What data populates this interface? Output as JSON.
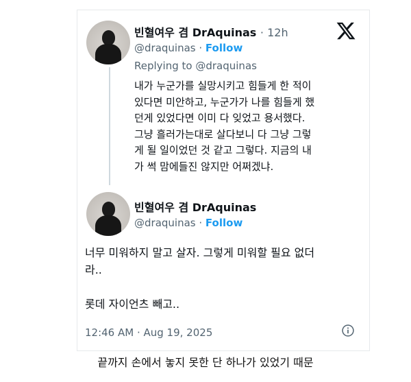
{
  "tweet1": {
    "display_name": "빈혈여우 겸 DrAquinas",
    "time": "· 12h",
    "handle": "@draquinas",
    "follow_label": "Follow",
    "replying_to_prefix": "Replying to",
    "replying_to_handle": "@draquinas",
    "text": "내가 누군가를 실망시키고 힘들게 한 적이\n있다면 미안하고, 누군가가 나를 힘들게 했\n던게 있었다면 이미 다 잊었고 용서했다.\n그냥 흘러가는대로 살다보니 다 그냥 그렇\n게 될 일이었던 것 같고 그렇다. 지금의 내\n가 썩 맘에들진 않지만 어쩌겠냐."
  },
  "tweet2": {
    "display_name": "빈혈여우 겸 DrAquinas",
    "handle": "@draquinas",
    "follow_label": "Follow",
    "text": "너무 미워하지 말고 살자. 그렇게 미워할 필요 없더\n라..\n\n롯데 자이언츠 빼고..",
    "timestamp": "12:46 AM · Aug 19, 2025"
  },
  "caption": "끝까지 손에서 놓지 못한 단 하나가 있었기 때문",
  "icons": {
    "brand": "x-logo-icon",
    "info": "info-icon"
  },
  "colors": {
    "follow": "#1d9bf0",
    "secondary_text": "#536471",
    "thread_line": "#cfd9de"
  }
}
